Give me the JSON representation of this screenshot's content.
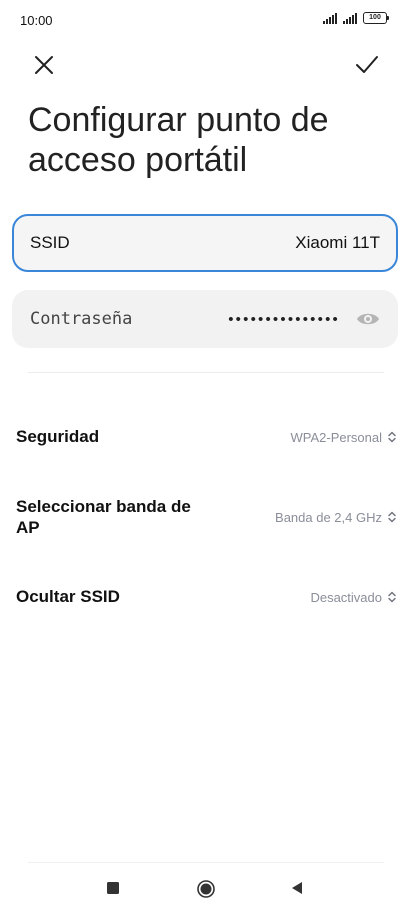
{
  "status_bar": {
    "time": "10:00",
    "battery": "100"
  },
  "header": {
    "title": "Configurar punto de acceso portátil"
  },
  "ssid": {
    "label": "SSID",
    "value": "Xiaomi 11T"
  },
  "password": {
    "label": "Contraseña",
    "value": "•••••••••••••••"
  },
  "settings": {
    "security": {
      "label": "Seguridad",
      "value": "WPA2-Personal"
    },
    "band": {
      "label": "Seleccionar banda de AP",
      "value": "Banda de 2,4 GHz"
    },
    "hide_ssid": {
      "label": "Ocultar SSID",
      "value": "Desactivado"
    }
  },
  "colors": {
    "accent": "#3a86d8",
    "field_bg": "#f2f2f2",
    "value_gray": "#8a8e99"
  },
  "icons": {
    "close": "close-icon",
    "confirm": "check-icon",
    "eye": "eye-icon",
    "chevron": "chevron-updown-icon",
    "nav_recents": "square-icon",
    "nav_home": "circle-icon",
    "nav_back": "triangle-back-icon"
  }
}
